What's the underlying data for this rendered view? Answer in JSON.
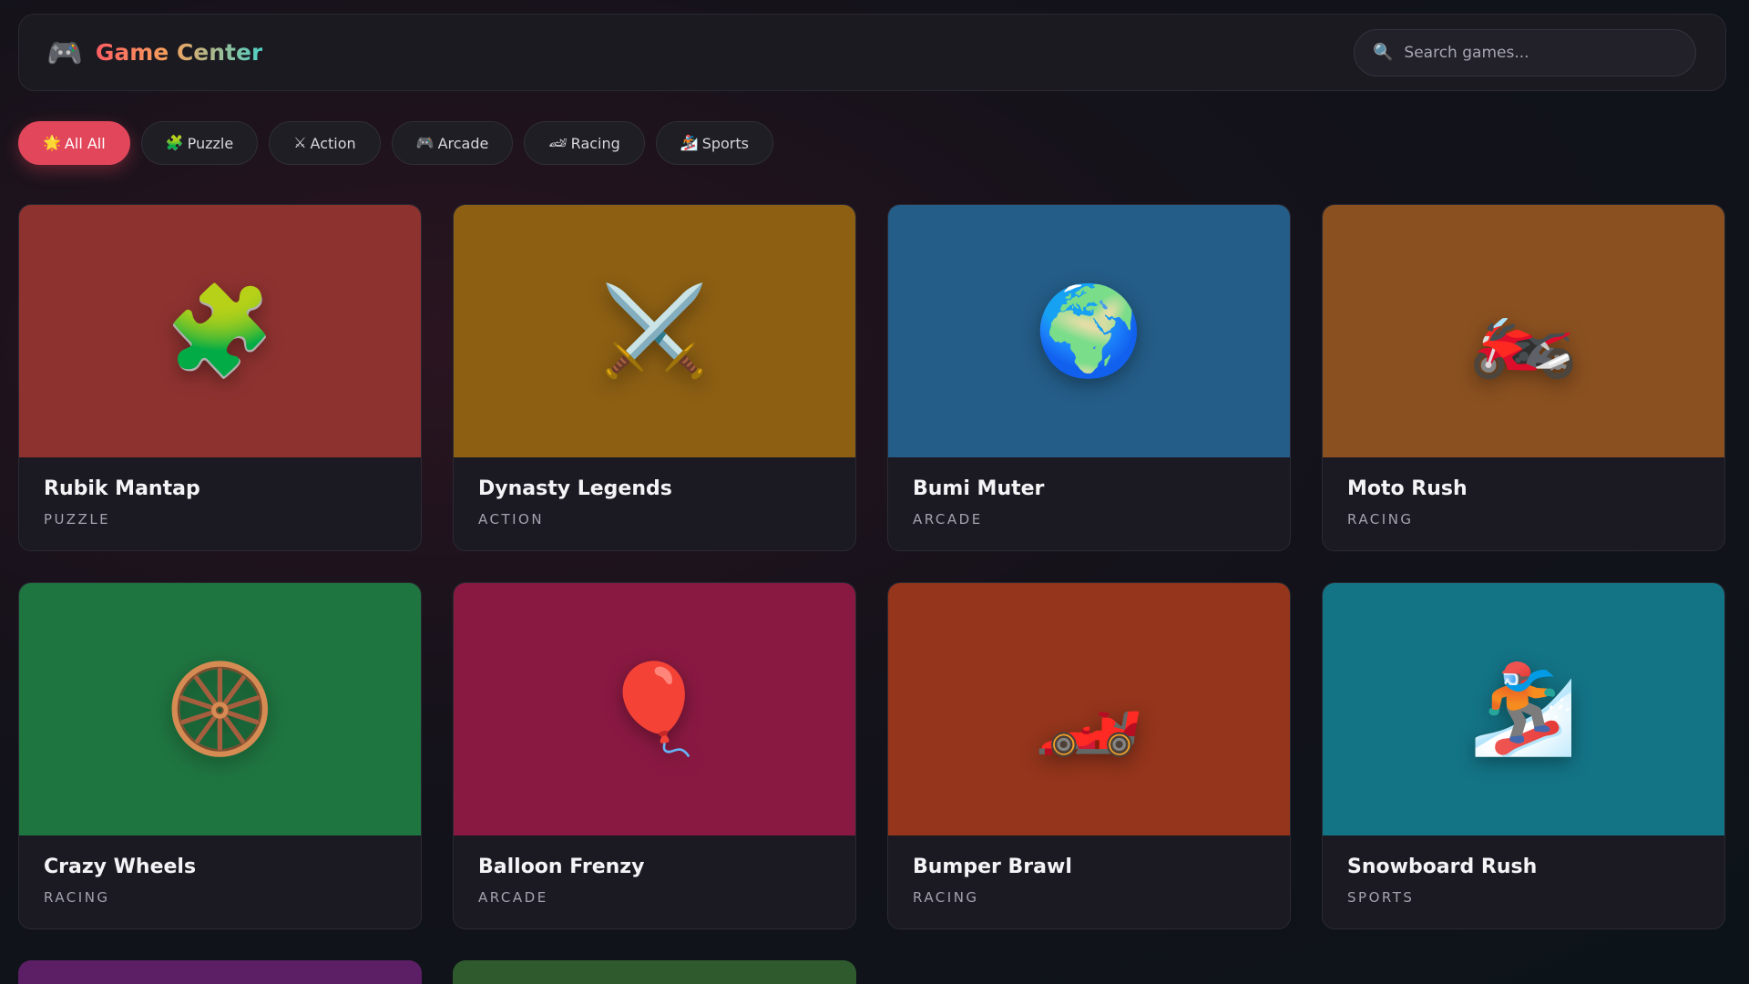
{
  "header": {
    "title": "Game Center",
    "logo_icon": "game-controller-icon",
    "search_placeholder": "Search games...",
    "search_value": "",
    "title_gradient": [
      "#ff5e62",
      "#f7a35c",
      "#4fd1c5"
    ]
  },
  "filters": [
    {
      "label": "All All",
      "icon": "🌟",
      "icon_name": "glowing-star-icon",
      "active": true
    },
    {
      "label": "Puzzle",
      "icon": "🧩",
      "icon_name": "puzzle-piece-icon",
      "active": false
    },
    {
      "label": "Action",
      "icon": "⚔",
      "icon_name": "crossed-swords-icon",
      "active": false
    },
    {
      "label": "Arcade",
      "icon": "🎮",
      "icon_name": "game-controller-icon",
      "active": false
    },
    {
      "label": "Racing",
      "icon": "🏎",
      "icon_name": "race-car-icon",
      "active": false
    },
    {
      "label": "Sports",
      "icon": "🏂",
      "icon_name": "snowboarder-icon",
      "active": false
    }
  ],
  "accent_color": "#e2465a",
  "games": [
    {
      "title": "Rubik Mantap",
      "category": "PUZZLE",
      "icon": "🧩",
      "icon_name": "puzzle-piece-icon",
      "color": "#8e3230"
    },
    {
      "title": "Dynasty Legends",
      "category": "ACTION",
      "icon": "⚔️",
      "icon_name": "crossed-swords-icon",
      "color": "#8c5f13"
    },
    {
      "title": "Bumi Muter",
      "category": "ARCADE",
      "icon": "🌍",
      "icon_name": "globe-icon",
      "color": "#245d88"
    },
    {
      "title": "Moto Rush",
      "category": "RACING",
      "icon": "🏍️",
      "icon_name": "motorcycle-icon",
      "color": "#8a5020"
    },
    {
      "title": "Crazy Wheels",
      "category": "RACING",
      "icon": "🛞",
      "icon_name": "wheel-icon",
      "color": "#1f7540"
    },
    {
      "title": "Balloon Frenzy",
      "category": "ARCADE",
      "icon": "🎈",
      "icon_name": "balloon-icon",
      "color": "#8a1942"
    },
    {
      "title": "Bumper Brawl",
      "category": "RACING",
      "icon": "🏎️",
      "icon_name": "race-car-icon",
      "color": "#94351c"
    },
    {
      "title": "Snowboard Rush",
      "category": "SPORTS",
      "icon": "🏂",
      "icon_name": "snowboarder-icon",
      "color": "#137486"
    }
  ],
  "partial_row_colors": [
    "#5c1f66",
    "#2e5a2e"
  ]
}
